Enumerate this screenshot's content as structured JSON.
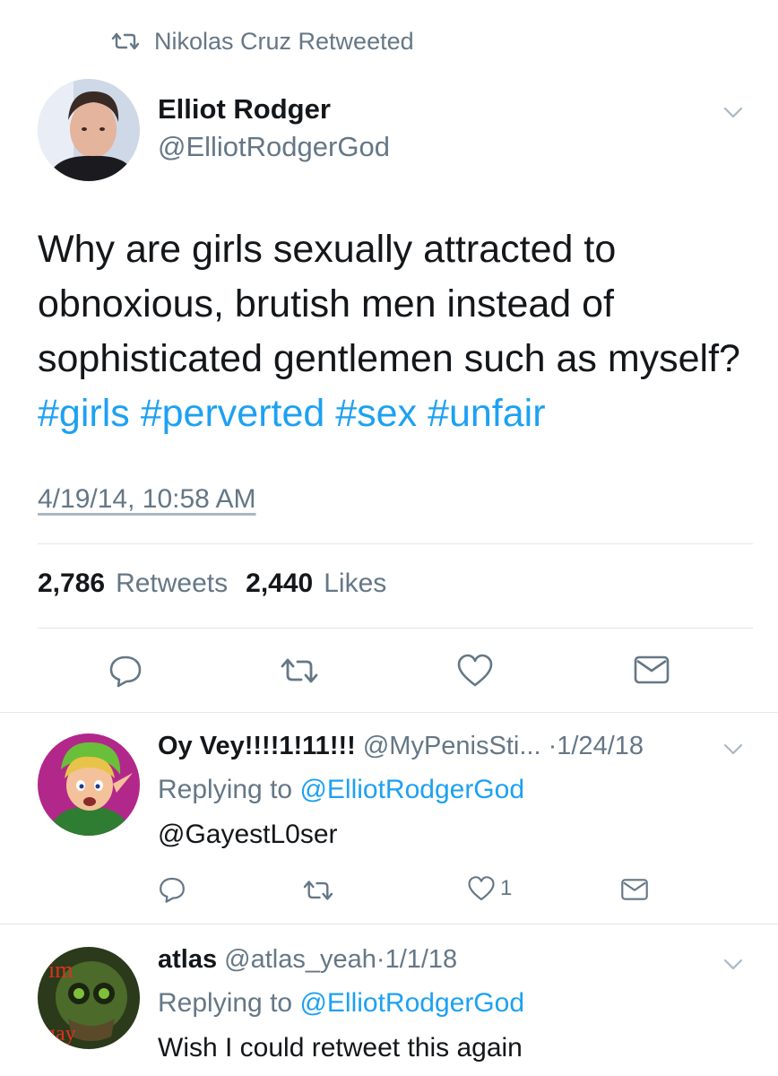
{
  "retweet_banner": {
    "text": "Nikolas Cruz Retweeted"
  },
  "main_tweet": {
    "author_name": "Elliot Rodger",
    "author_handle": "@ElliotRodgerGod",
    "text_plain": "Why are girls sexually attracted to obnoxious, brutish men instead of sophisticated gentlemen such as myself?",
    "hashtags": [
      "#girls",
      "#perverted",
      "#sex",
      "#unfair"
    ],
    "timestamp": "4/19/14, 10:58 AM",
    "retweet_count": "2,786",
    "retweet_label": "Retweets",
    "like_count": "2,440",
    "like_label": "Likes"
  },
  "replies": [
    {
      "display_name": "Oy Vey!!!!1!11!!!",
      "handle": "@MyPenisSti...",
      "separator": "·",
      "date": "1/24/18",
      "replying_prefix": "Replying to",
      "replying_to": "@ElliotRodgerGod",
      "text": "@GayestL0ser",
      "like_count": "1"
    },
    {
      "display_name": "atlas",
      "handle": "@atlas_yeah",
      "separator": "·",
      "date": "1/1/18",
      "replying_prefix": "Replying to",
      "replying_to": "@ElliotRodgerGod",
      "text": "Wish I could retweet this again",
      "avatar_text_top": "im",
      "avatar_text_bottom": "gay"
    }
  ],
  "icons": {
    "retweet": "retweet-icon",
    "reply": "reply-icon",
    "like": "heart-icon",
    "dm": "mail-icon",
    "menu": "chevron-down-icon"
  },
  "colors": {
    "link": "#1da1f2",
    "muted": "#657786",
    "text": "#14171a",
    "divider": "#e1e8ed"
  }
}
